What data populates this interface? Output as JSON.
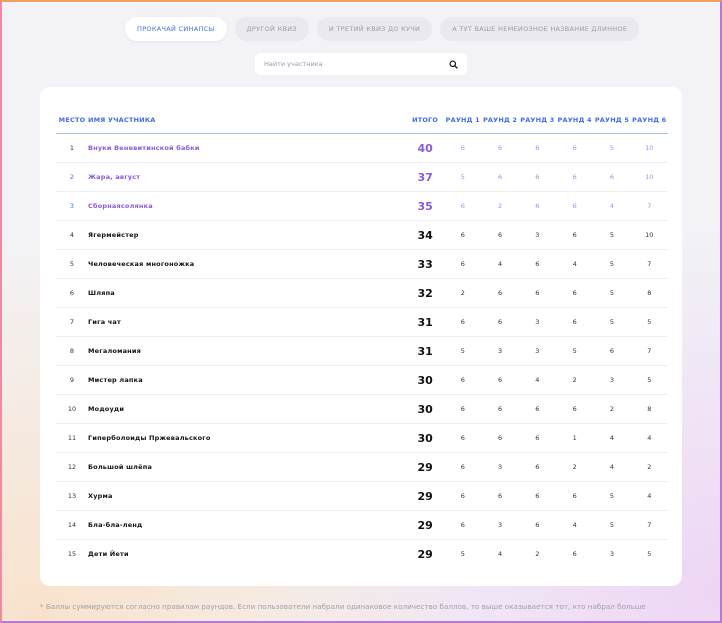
{
  "tabs": [
    {
      "label": "Прокачай синапсы",
      "active": true
    },
    {
      "label": "Другой квиз",
      "active": false
    },
    {
      "label": "И третий квиз до кучи",
      "active": false
    },
    {
      "label": "А тут ваше немеиозное название длинное",
      "active": false
    }
  ],
  "search": {
    "placeholder": "Найти участника",
    "icon": "search-icon"
  },
  "table": {
    "headers": {
      "place": "Место",
      "name": "Имя участника",
      "total": "Итого",
      "rounds": [
        "Раунд 1",
        "Раунд 2",
        "Раунд 3",
        "Раунд 4",
        "Раунд 5",
        "Раунд 6"
      ]
    },
    "rows": [
      {
        "place": "1",
        "name": "Внуки Веневитинской бабки",
        "total": "40",
        "rounds": [
          "6",
          "6",
          "6",
          "6",
          "5",
          "10"
        ]
      },
      {
        "place": "2",
        "name": "Жара, август",
        "total": "37",
        "rounds": [
          "5",
          "6",
          "6",
          "6",
          "6",
          "10"
        ]
      },
      {
        "place": "3",
        "name": "Сборнаясолянка",
        "total": "35",
        "rounds": [
          "6",
          "2",
          "6",
          "6",
          "4",
          "7"
        ]
      },
      {
        "place": "4",
        "name": "Ягермейстер",
        "total": "34",
        "rounds": [
          "6",
          "6",
          "3",
          "6",
          "5",
          "10"
        ]
      },
      {
        "place": "5",
        "name": "Человеческая многоножка",
        "total": "33",
        "rounds": [
          "6",
          "4",
          "6",
          "4",
          "5",
          "7"
        ]
      },
      {
        "place": "6",
        "name": "Шляпа",
        "total": "32",
        "rounds": [
          "2",
          "6",
          "6",
          "6",
          "5",
          "8"
        ]
      },
      {
        "place": "7",
        "name": "Гига чат",
        "total": "31",
        "rounds": [
          "6",
          "6",
          "3",
          "6",
          "5",
          "5"
        ]
      },
      {
        "place": "8",
        "name": "Мегаломания",
        "total": "31",
        "rounds": [
          "5",
          "3",
          "3",
          "5",
          "6",
          "7"
        ]
      },
      {
        "place": "9",
        "name": "Мистер лапка",
        "total": "30",
        "rounds": [
          "6",
          "6",
          "4",
          "2",
          "3",
          "5"
        ]
      },
      {
        "place": "10",
        "name": "Модоуди",
        "total": "30",
        "rounds": [
          "6",
          "6",
          "6",
          "6",
          "2",
          "8"
        ]
      },
      {
        "place": "11",
        "name": "Гиперболоиды Пржевальского",
        "total": "30",
        "rounds": [
          "6",
          "6",
          "6",
          "1",
          "4",
          "4"
        ]
      },
      {
        "place": "12",
        "name": "Большой шлёпа",
        "total": "29",
        "rounds": [
          "6",
          "3",
          "6",
          "2",
          "4",
          "2"
        ]
      },
      {
        "place": "13",
        "name": "Хурма",
        "total": "29",
        "rounds": [
          "6",
          "6",
          "6",
          "6",
          "5",
          "4"
        ]
      },
      {
        "place": "14",
        "name": "Бла-бла-ленд",
        "total": "29",
        "rounds": [
          "6",
          "3",
          "6",
          "4",
          "5",
          "7"
        ]
      },
      {
        "place": "15",
        "name": "Дети Йети",
        "total": "29",
        "rounds": [
          "5",
          "4",
          "2",
          "6",
          "3",
          "5"
        ]
      }
    ]
  },
  "footnote": "* Баллы суммируются согласно правилам раундов. Если пользователи набрали одинаковое количество баллов, то выше оказывается тот, кто набрал больше",
  "colors": {
    "accent": "#3d6fe0",
    "highlight": "#8a5bd8"
  }
}
